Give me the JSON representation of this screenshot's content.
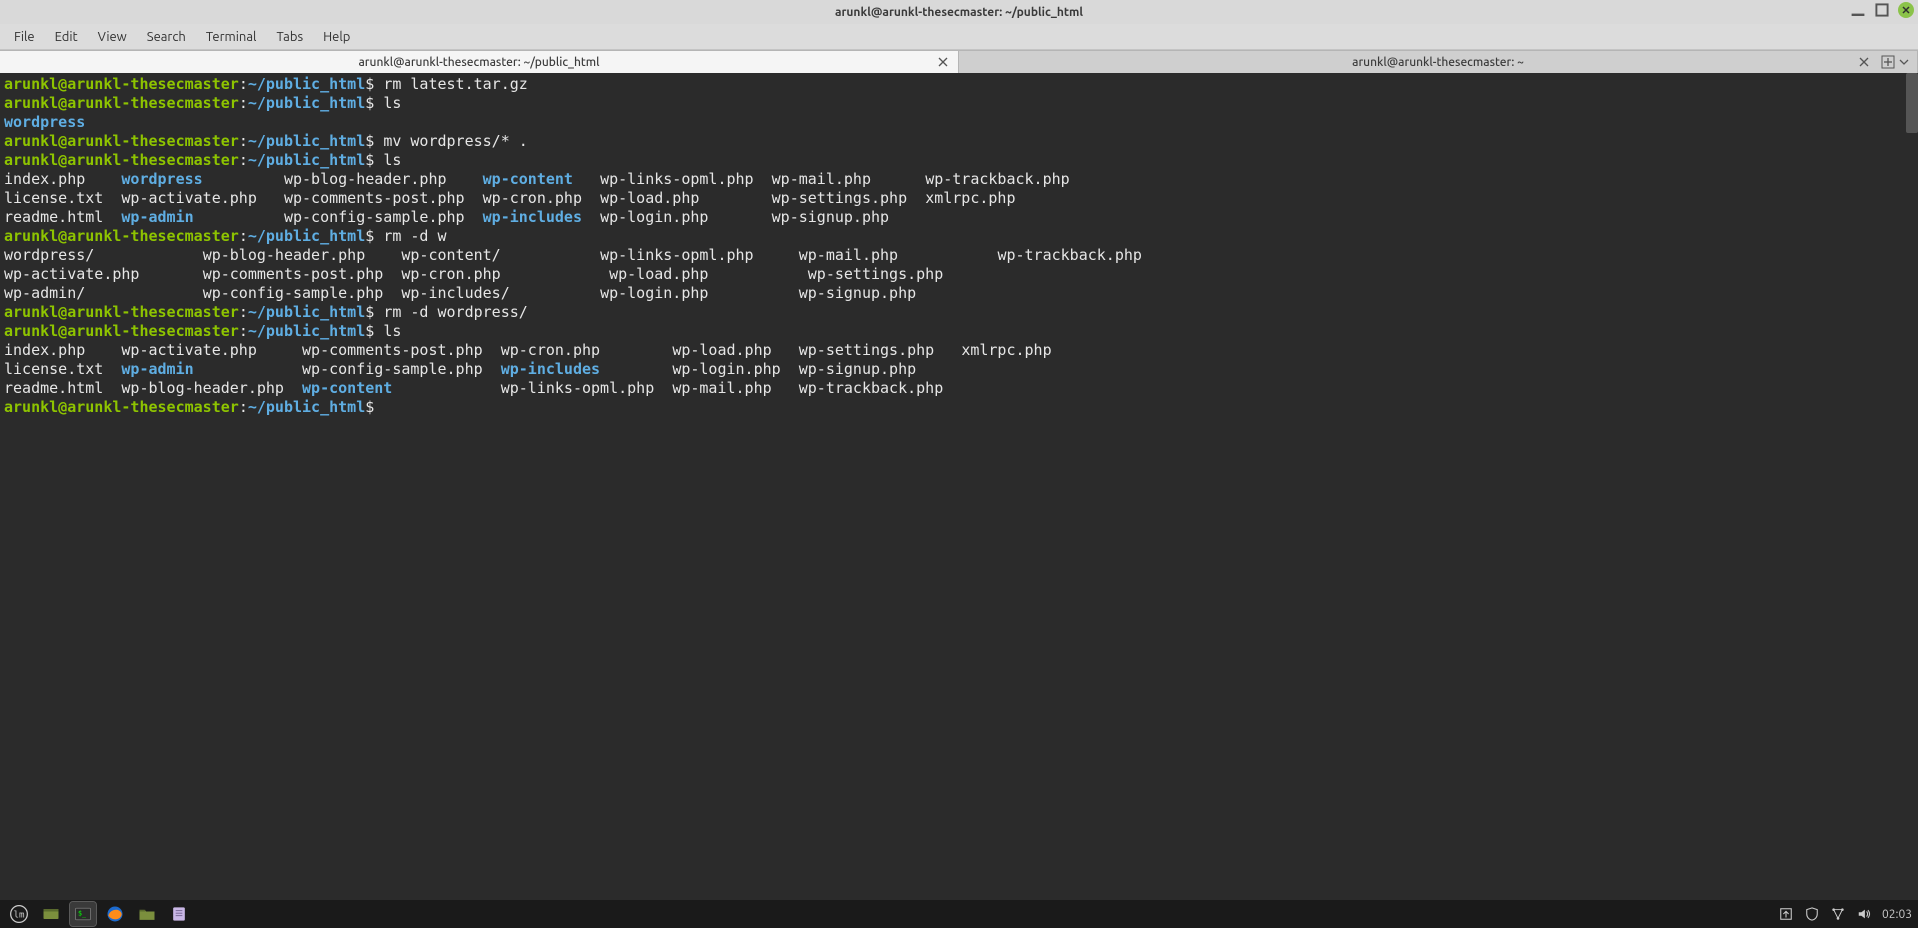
{
  "window": {
    "title": "arunkl@arunkl-thesecmaster: ~/public_html"
  },
  "menubar": [
    "File",
    "Edit",
    "View",
    "Search",
    "Terminal",
    "Tabs",
    "Help"
  ],
  "tabs": [
    {
      "label": "arunkl@arunkl-thesecmaster: ~/public_html",
      "active": true
    },
    {
      "label": "arunkl@arunkl-thesecmaster: ~",
      "active": false
    }
  ],
  "prompt": {
    "user": "arunkl@arunkl-thesecmaster",
    "sep1": ":",
    "path": "~/public_html",
    "sep2": "$ "
  },
  "commands": {
    "c1": "rm latest.tar.gz",
    "c2": "ls",
    "c3": "mv wordpress/* .",
    "c4": "ls",
    "c5": "rm -d w",
    "c6": "rm -d wordpress/",
    "c7": "ls",
    "c8": ""
  },
  "ls1": {
    "wordpress": "wordpress"
  },
  "ls2": {
    "row1": {
      "c1": "index.php",
      "c2": "wordpress",
      "c3": "wp-blog-header.php",
      "c4": "wp-content",
      "c5": "wp-links-opml.php",
      "c6": "wp-mail.php",
      "c7": "wp-trackback.php"
    },
    "row2": {
      "c1": "license.txt",
      "c2": "wp-activate.php",
      "c3": "wp-comments-post.php",
      "c4": "wp-cron.php",
      "c5": "wp-load.php",
      "c6": "wp-settings.php",
      "c7": "xmlrpc.php"
    },
    "row3": {
      "c1": "readme.html",
      "c2": "wp-admin",
      "c3": "wp-config-sample.php",
      "c4": "wp-includes",
      "c5": "wp-login.php",
      "c6": "wp-signup.php"
    }
  },
  "tab_completion": {
    "row1": {
      "c1": "wordpress/",
      "c2": "wp-blog-header.php",
      "c3": "wp-content/",
      "c4": "wp-links-opml.php",
      "c5": "wp-mail.php",
      "c6": "wp-trackback.php"
    },
    "row2": {
      "c1": "wp-activate.php",
      "c2": "wp-comments-post.php",
      "c3": "wp-cron.php",
      "c4": "wp-load.php",
      "c5": "wp-settings.php"
    },
    "row3": {
      "c1": "wp-admin/",
      "c2": "wp-config-sample.php",
      "c3": "wp-includes/",
      "c4": "wp-login.php",
      "c5": "wp-signup.php"
    }
  },
  "ls3": {
    "row1": {
      "c1": "index.php",
      "c2": "wp-activate.php",
      "c3": "wp-comments-post.php",
      "c4": "wp-cron.php",
      "c5": "wp-load.php",
      "c6": "wp-settings.php",
      "c7": "xmlrpc.php"
    },
    "row2": {
      "c1": "license.txt",
      "c2": "wp-admin",
      "c3": "wp-config-sample.php",
      "c4": "wp-includes",
      "c5": "wp-login.php",
      "c6": "wp-signup.php"
    },
    "row3": {
      "c1": "readme.html",
      "c2": "wp-blog-header.php",
      "c3": "wp-content",
      "c4": "wp-links-opml.php",
      "c5": "wp-mail.php",
      "c6": "wp-trackback.php"
    }
  },
  "taskbar": {
    "clock": "02:03"
  }
}
